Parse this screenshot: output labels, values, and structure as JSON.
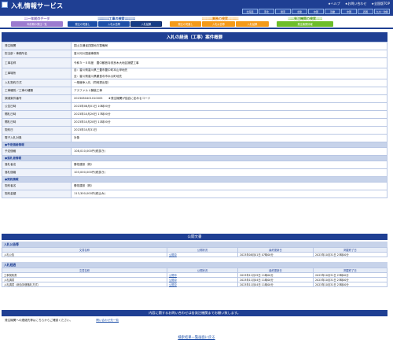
{
  "header": {
    "title": "入札情報サービス",
    "toplinks": [
      "★ヘルプ",
      "★お問い合わせ",
      "★全国版TOP"
    ],
    "regions": [
      "北海道",
      "東北",
      "関東",
      "北陸",
      "中部",
      "近畿",
      "中国",
      "四国",
      "九州・沖縄"
    ]
  },
  "categories": {
    "prev": {
      "title": "一年前のデータ",
      "buttons": [
        "年前期の発注一覧"
      ]
    },
    "koji": {
      "title": "工事の検索",
      "buttons": [
        "発注の見通し",
        "入札公告等",
        "入札結果"
      ]
    },
    "gyomu": {
      "title": "業務の検索",
      "buttons": [
        "発注の見通し",
        "入札公告等",
        "入札結果"
      ]
    },
    "hatchu": {
      "title": "発注機関の検索",
      "buttons": [
        "発注機関情報"
      ]
    }
  },
  "detail": {
    "title": "入札の経過（工事）案件概要",
    "rows": [
      {
        "label": "発注機関",
        "value": "国土交通省四国地方整備局"
      },
      {
        "label": "担当部・事務所名",
        "value": "香川河川国道事務所"
      },
      {
        "label": "工事名称",
        "value": "令和５－６年度　豊中観音寺改良木大地区擁壁工事"
      },
      {
        "label": "工事場所",
        "value": "自：香川県香川県三豊市豊中町本山甲地先",
        "value2": "至：香川県香川県観音寺市木大町地先"
      },
      {
        "label": "入札契約方式",
        "value": "一般競争入札（同時提出型）"
      },
      {
        "label": "工事種別／工事の種類",
        "value": "アスファルト舗装工事"
      },
      {
        "label": "調達案件番号",
        "value": "2023080401010005　　★発注機関が独自に定めるコード"
      },
      {
        "label": "公告日時",
        "value": "2023年08月01日 10時00分"
      },
      {
        "label": "開札日時",
        "value": "2023年10月26日 17時00分"
      },
      {
        "label": "開札日時",
        "value": "2023年10月28日 11時00分"
      },
      {
        "label": "契約日",
        "value": "2023年10月31日"
      },
      {
        "label": "電子入札対象",
        "value": "対象"
      }
    ],
    "section1": "●予定価格情報",
    "rows1": [
      {
        "label": "予定価格",
        "value": "108,010,000円(税抜き)"
      }
    ],
    "section2": "●落札者情報",
    "rows2": [
      {
        "label": "落札者名",
        "value": "勝佑建設（株）"
      },
      {
        "label": "落札価格",
        "value": "103,000,000円(税抜き)"
      }
    ],
    "section3": "●契約情報",
    "rows3": [
      {
        "label": "契約者名",
        "value": "勝佑建設（株）"
      },
      {
        "label": "契約金額",
        "value": "113,300,000円(税込み)"
      }
    ]
  },
  "docs": {
    "title": "公開文書",
    "sec1": "入札公告等",
    "headers": [
      "文書名称",
      "公開状況",
      "最終更新日",
      "掲載終了日"
    ],
    "rows1": [
      [
        "入札公告",
        "公開中",
        "2023年08月01日 07時00分",
        "2023年10月31日 23時00分"
      ]
    ],
    "sec2": "入札経過",
    "rows2": [
      [
        "工事契約書",
        "公開中",
        "2023年11月29日 11時00分",
        "2023年10月31日 23時00分"
      ],
      [
        "入札調書",
        "公開中",
        "2023年11月04日 11時00分",
        "2023年10月31日 23時00分"
      ],
      [
        "入札調書（総合評価落札方式）",
        "公開中",
        "2023年11月04日 11時00分",
        "2023年10月31日 23時00分"
      ]
    ]
  },
  "contact": {
    "title": "内容に関するお問い合わせは各発注機関までお願い致します。",
    "left": "発注機関への連絡先等はこちらからご確認ください。",
    "link": "問い合わせ先一覧"
  },
  "back_link": "検索結果一覧画面に戻る"
}
